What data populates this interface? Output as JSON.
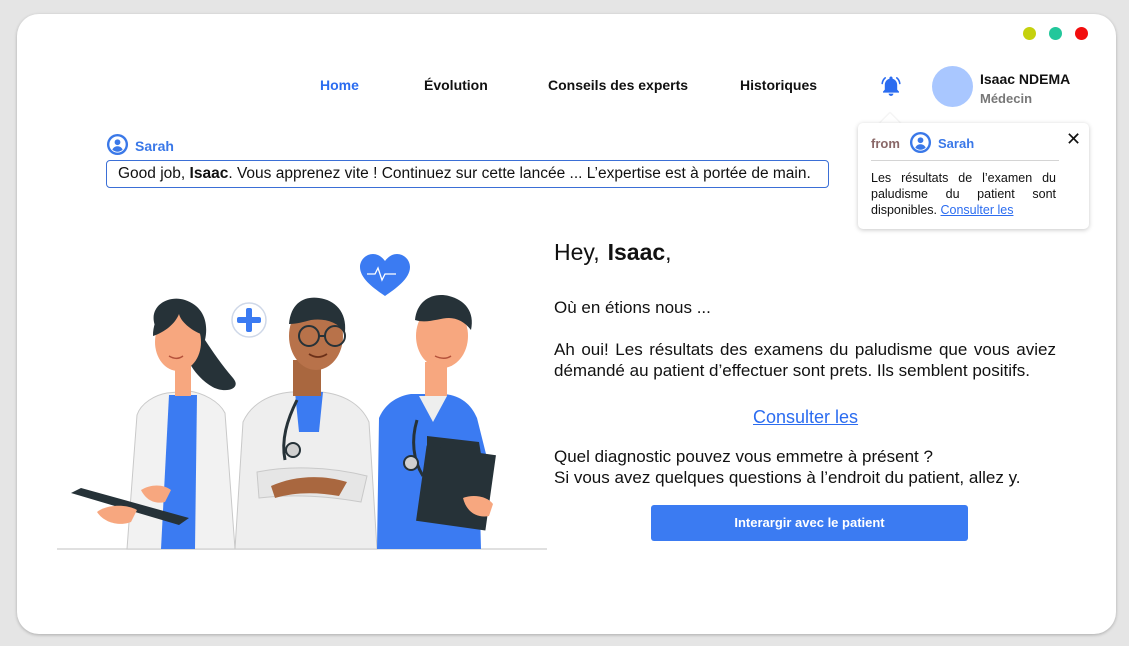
{
  "window_controls": [
    "minimize",
    "maximize",
    "close"
  ],
  "nav": {
    "items": [
      {
        "label": "Home",
        "active": true
      },
      {
        "label": "Évolution"
      },
      {
        "label": "Conseils des experts"
      },
      {
        "label": "Historiques"
      }
    ]
  },
  "user": {
    "name": "Isaac NDEMA",
    "role": "Médecin"
  },
  "notification": {
    "from_label": "from",
    "sender": "Sarah",
    "text": "Les résultats de l’examen du paludisme du patient sont disponibles.",
    "link": "Consulter les",
    "close_symbol": "✕"
  },
  "message": {
    "sender": "Sarah",
    "prefix": "Good job, ",
    "name": "Isaac",
    "suffix": ". Vous apprenez vite ! Continuez sur cette lancée ... L’expertise est à portée de main."
  },
  "main": {
    "greeting": "Hey,",
    "greeting_name": "Isaac",
    "greeting_end": ",",
    "line1": "Où en étions nous ...",
    "line2": "Ah oui!  Les résultats des examens du paludisme que vous aviez démandé au patient d’effectuer sont prets. Ils semblent positifs.",
    "consult_link": "Consulter les",
    "line3": "Quel diagnostic pouvez vous emmetre à présent ?",
    "line4": "Si vous avez quelques questions à l’endroit du patient, allez y.",
    "cta": "Interargir avec le patient"
  },
  "colors": {
    "accent": "#3b7bf2",
    "link": "#2b6cf0",
    "avatar": "#a9c7ff",
    "dot_yellow": "#c5d10d",
    "dot_green": "#22c79b",
    "dot_red": "#f20d0d"
  },
  "icons": [
    "bell-icon",
    "user-circle-icon",
    "close-icon",
    "heart-icon",
    "plus-icon"
  ]
}
